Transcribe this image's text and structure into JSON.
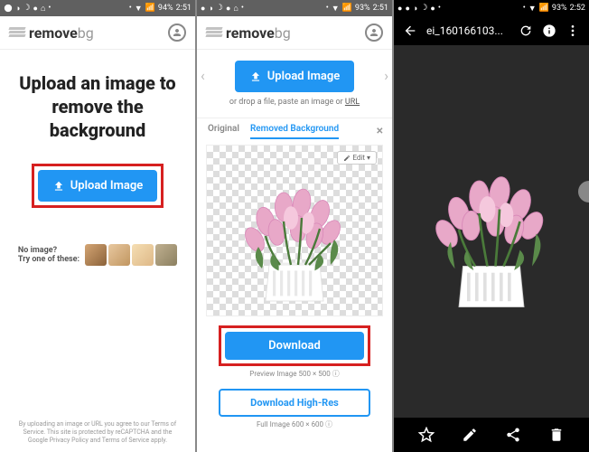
{
  "status": {
    "battery": "94%",
    "time": "2:51",
    "battery3": "93%",
    "time3": "2:52"
  },
  "logo": {
    "text1": "remove",
    "text2": "bg"
  },
  "panel1": {
    "heading": "Upload an image to\nremove the background",
    "upload_label": "Upload Image",
    "noimage_label": "No image?\nTry one of these:",
    "fine_print": "By uploading an image or URL you agree to our Terms of Service. This site is protected by reCAPTCHA and the Google Privacy Policy and Terms of Service apply."
  },
  "panel2": {
    "upload_label": "Upload Image",
    "drop_text": "or drop a file, paste an image or ",
    "url_text": "URL",
    "tab_original": "Original",
    "tab_removed": "Removed Background",
    "edit_label": "Edit",
    "download_label": "Download",
    "preview_caption": "Preview Image 500 × 500",
    "download_hires_label": "Download High-Res",
    "full_caption": "Full Image 600 × 600"
  },
  "panel3": {
    "filename": "ei_160166103..."
  }
}
